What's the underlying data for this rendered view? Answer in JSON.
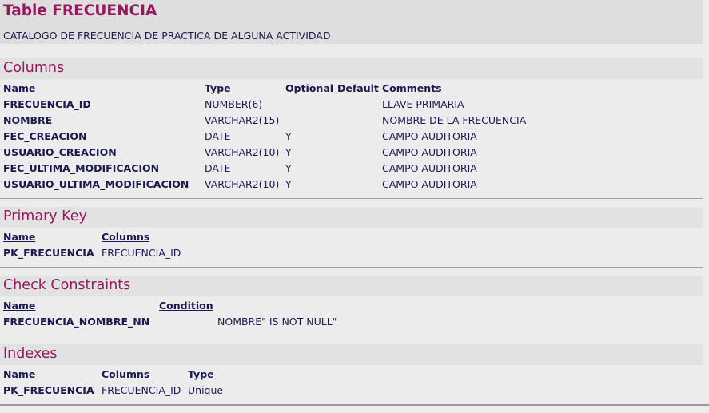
{
  "table": {
    "title": "Table FRECUENCIA",
    "description": "CATALOGO DE FRECUENCIA DE PRACTICA DE ALGUNA ACTIVIDAD"
  },
  "columns_section": {
    "title": "Columns",
    "headers": [
      "Name",
      "Type",
      "Optional",
      "Default",
      "Comments"
    ],
    "rows": [
      {
        "name": "FRECUENCIA_ID",
        "type": "NUMBER(6)",
        "optional": "",
        "default": "",
        "comments": "LLAVE PRIMARIA"
      },
      {
        "name": "NOMBRE",
        "type": "VARCHAR2(15)",
        "optional": "",
        "default": "",
        "comments": "NOMBRE DE LA FRECUENCIA"
      },
      {
        "name": "FEC_CREACION",
        "type": "DATE",
        "optional": "Y",
        "default": "",
        "comments": "CAMPO AUDITORIA"
      },
      {
        "name": "USUARIO_CREACION",
        "type": "VARCHAR2(10)",
        "optional": "Y",
        "default": "",
        "comments": "CAMPO AUDITORIA"
      },
      {
        "name": "FEC_ULTIMA_MODIFICACION",
        "type": "DATE",
        "optional": "Y",
        "default": "",
        "comments": "CAMPO AUDITORIA"
      },
      {
        "name": "USUARIO_ULTIMA_MODIFICACION",
        "type": "VARCHAR2(10)",
        "optional": "Y",
        "default": "",
        "comments": "CAMPO AUDITORIA"
      }
    ]
  },
  "primary_key_section": {
    "title": "Primary Key",
    "headers": [
      "Name",
      "Columns"
    ],
    "rows": [
      {
        "name": "PK_FRECUENCIA",
        "columns": "FRECUENCIA_ID"
      }
    ]
  },
  "check_constraints_section": {
    "title": "Check Constraints",
    "headers": [
      "Name",
      "Condition"
    ],
    "rows": [
      {
        "name": "FRECUENCIA_NOMBRE_NN",
        "condition": "NOMBRE\" IS NOT NULL\""
      }
    ]
  },
  "indexes_section": {
    "title": "Indexes",
    "headers": [
      "Name",
      "Columns",
      "Type"
    ],
    "rows": [
      {
        "name": "PK_FRECUENCIA",
        "columns": "FRECUENCIA_ID",
        "type": "Unique"
      }
    ]
  }
}
